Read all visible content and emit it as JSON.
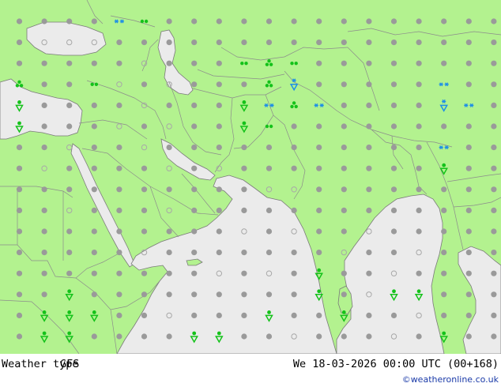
{
  "footer": {
    "title": "Weather type",
    "model": "GFS",
    "datetime": "We 18-03-2026 00:00 UTC (00+168)",
    "credit": "©weatheronline.co.uk"
  },
  "colors": {
    "land": "#b3f28f",
    "sea": "#ebebeb",
    "border": "#8c8c8c",
    "coast": "#7a7a7a",
    "dot_cloudy": "#9a9a9a",
    "dot_clear": "#a8a8a8",
    "rain": "#14c21a",
    "snow": "#1e8fe6"
  },
  "symbols": [
    {
      "col": 4,
      "row": 0,
      "type": "snow"
    },
    {
      "col": 5,
      "row": 0,
      "type": "drizzle"
    },
    {
      "col": 9,
      "row": 2,
      "type": "drizzle"
    },
    {
      "col": 10,
      "row": 2,
      "type": "rain"
    },
    {
      "col": 11,
      "row": 2,
      "type": "drizzle"
    },
    {
      "col": 0,
      "row": 3,
      "type": "rain"
    },
    {
      "col": 3,
      "row": 3,
      "type": "drizzle"
    },
    {
      "col": 10,
      "row": 3,
      "type": "rain"
    },
    {
      "col": 11,
      "row": 3,
      "type": "snow_shower"
    },
    {
      "col": 17,
      "row": 3,
      "type": "snow"
    },
    {
      "col": 0,
      "row": 4,
      "type": "shower"
    },
    {
      "col": 9,
      "row": 4,
      "type": "shower"
    },
    {
      "col": 10,
      "row": 4,
      "type": "snow"
    },
    {
      "col": 11,
      "row": 4,
      "type": "rain"
    },
    {
      "col": 12,
      "row": 4,
      "type": "snow"
    },
    {
      "col": 17,
      "row": 4,
      "type": "snow_shower"
    },
    {
      "col": 18,
      "row": 4,
      "type": "snow"
    },
    {
      "col": 0,
      "row": 5,
      "type": "shower"
    },
    {
      "col": 9,
      "row": 5,
      "type": "shower"
    },
    {
      "col": 10,
      "row": 5,
      "type": "drizzle"
    },
    {
      "col": 17,
      "row": 6,
      "type": "snow"
    },
    {
      "col": 17,
      "row": 7,
      "type": "shower"
    },
    {
      "col": 12,
      "row": 12,
      "type": "shower"
    },
    {
      "col": 2,
      "row": 13,
      "type": "shower"
    },
    {
      "col": 12,
      "row": 13,
      "type": "shower"
    },
    {
      "col": 15,
      "row": 13,
      "type": "shower"
    },
    {
      "col": 16,
      "row": 13,
      "type": "shower"
    },
    {
      "col": 1,
      "row": 14,
      "type": "shower"
    },
    {
      "col": 2,
      "row": 14,
      "type": "shower"
    },
    {
      "col": 3,
      "row": 14,
      "type": "shower"
    },
    {
      "col": 10,
      "row": 14,
      "type": "shower"
    },
    {
      "col": 13,
      "row": 14,
      "type": "shower"
    },
    {
      "col": 1,
      "row": 15,
      "type": "shower"
    },
    {
      "col": 2,
      "row": 15,
      "type": "shower"
    },
    {
      "col": 7,
      "row": 15,
      "type": "shower"
    },
    {
      "col": 8,
      "row": 15,
      "type": "shower"
    },
    {
      "col": 17,
      "row": 15,
      "type": "shower"
    }
  ],
  "clear_dots": [
    [
      1,
      1
    ],
    [
      2,
      1
    ],
    [
      3,
      1
    ],
    [
      5,
      2
    ],
    [
      4,
      3
    ],
    [
      6,
      3
    ],
    [
      5,
      4
    ],
    [
      4,
      5
    ],
    [
      6,
      5
    ],
    [
      2,
      6
    ],
    [
      5,
      6
    ],
    [
      1,
      7
    ],
    [
      6,
      7
    ],
    [
      8,
      7
    ],
    [
      10,
      8
    ],
    [
      11,
      8
    ],
    [
      2,
      9
    ],
    [
      6,
      9
    ],
    [
      9,
      10
    ],
    [
      11,
      10
    ],
    [
      14,
      10
    ],
    [
      5,
      11
    ],
    [
      13,
      11
    ],
    [
      16,
      11
    ],
    [
      8,
      12
    ],
    [
      10,
      12
    ],
    [
      15,
      12
    ],
    [
      14,
      13
    ],
    [
      6,
      14
    ],
    [
      16,
      14
    ],
    [
      11,
      15
    ],
    [
      15,
      15
    ]
  ]
}
